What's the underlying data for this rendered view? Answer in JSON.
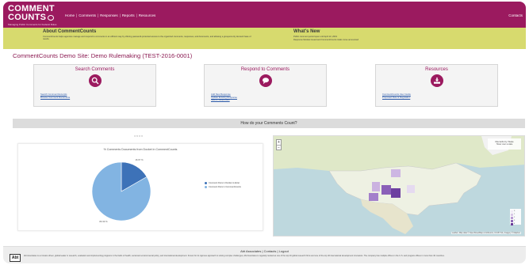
{
  "header": {
    "logo_line1": "COMMENT",
    "logo_line2": "COUNTS",
    "tagline": "Managing Public Comments for Federal Rules",
    "nav": [
      "Home",
      "Comments",
      "Responses",
      "Reports",
      "Resources"
    ],
    "contacts": "Contacts",
    "accent": "#9b1a5f"
  },
  "band": {
    "about_title": "About CommentCounts",
    "about_text": "CommentCounts helps agencies manage and respond to comments in an efficient way by offering password-protected access to the organized comments, responses, and documents, and allowing a grouped-only demand base of results.",
    "news_title": "What's New",
    "news_items": [
      "Public comment period open until April 22, 2019",
      "Response Module Issued and CommentCounts totals move announced"
    ],
    "color": "#d7da6e"
  },
  "page_title": "CommentCounts Demo Site: Demo Rulemaking (TEST-2016-0001)",
  "cards": [
    {
      "title": "Search Comments",
      "icon": "search-icon",
      "links": [
        "Search Comment Excerpts",
        "Browse Comment Documents"
      ]
    },
    {
      "title": "Respond to Comments",
      "icon": "chat-bubble-icon",
      "links": [
        "Add New Response",
        "Update Existing Response",
        "Search Responses"
      ]
    },
    {
      "title": "Resources",
      "icon": "download-icon",
      "links": [
        "CommentCounts User Guide",
        "Proposed Rule & Regulation"
      ]
    }
  ],
  "strip_title": "How do your Comments Count?",
  "pager_dots": "○○○○",
  "chart_data": {
    "type": "pie",
    "title": "% Comments Documents from Docket in CommentCounts",
    "slices": [
      {
        "name": "Comment Docs in Docket to Enter",
        "value": 16.67,
        "label": "16.67 %",
        "color": "#3d72b8"
      },
      {
        "name": "Comment Docs in CommentCounts",
        "value": 83.33,
        "label": "83.33 %",
        "color": "#82b4e2"
      }
    ],
    "legend": "right"
  },
  "map": {
    "legend_title": "Records by State",
    "legend_sub": "Hover over a state",
    "scale": [
      "0",
      "1",
      "2",
      "3",
      "4"
    ],
    "scale_colors": [
      "#f2ecf6",
      "#d9c8e6",
      "#b99bd4",
      "#8f6ab8",
      "#6a3b99"
    ],
    "attribution": "Leaflet | Map data © OpenStreetMap contributors, CC-BY-SA, Imagery © Mapbox",
    "zoom_in": "+",
    "zoom_out": "−"
  },
  "footer": {
    "links": "Abt Associates | Contacts | Logout",
    "logo": "Abt",
    "text": "Abt Associates is a mission-driven, global leader in research, evaluation and implementing programs in the fields of health, social and environmental policy, and international development. Known for its rigorous approach to solving complex challenges, Abt Associates is regularly ranked as one of the top 20 global research firms and one of the top 40 international development innovators. The company has multiple offices in the U.S. and program offices in more than 40 countries."
  }
}
